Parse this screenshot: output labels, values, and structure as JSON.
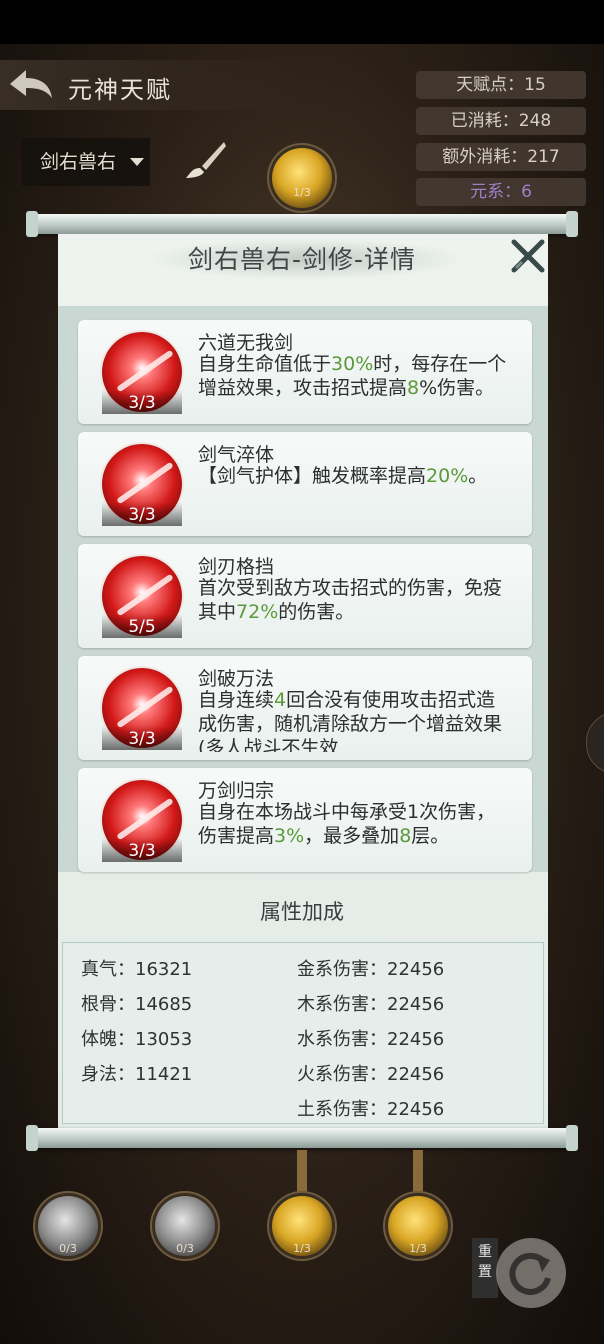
{
  "header": {
    "title": "元神天赋"
  },
  "stats": {
    "talent_points": "天赋点：15",
    "consumed": "已消耗：248",
    "extra_consumed": "额外消耗：217",
    "element": "元系：6"
  },
  "selector": {
    "value": "剑右兽右"
  },
  "nodes": {
    "top": "1/3",
    "bottom": [
      "0/3",
      "0/3",
      "1/3",
      "1/3"
    ]
  },
  "panel": {
    "title": "剑右兽右-剑修-详情",
    "skills": [
      {
        "name": "六道无我剑",
        "level": "3/3",
        "desc": [
          {
            "t": "自身生命值低于"
          },
          {
            "t": "30%",
            "hl": true
          },
          {
            "t": "时，每存在一个增益效果，攻击招式提高"
          },
          {
            "t": "8",
            "hl": true
          },
          {
            "t": "%伤害。"
          }
        ]
      },
      {
        "name": "剑气淬体",
        "level": "3/3",
        "desc": [
          {
            "t": "【剑气护体】触发概率提高"
          },
          {
            "t": "20%",
            "hl": true
          },
          {
            "t": "。"
          }
        ]
      },
      {
        "name": "剑刃格挡",
        "level": "5/5",
        "desc": [
          {
            "t": "首次受到敌方攻击招式的伤害，免疫其中"
          },
          {
            "t": "72%",
            "hl": true
          },
          {
            "t": "的伤害。"
          }
        ]
      },
      {
        "name": "剑破万法",
        "level": "3/3",
        "desc": [
          {
            "t": "自身连续"
          },
          {
            "t": "4",
            "hl": true
          },
          {
            "t": "回合没有使用攻击招式造成伤害，随机清除敌方一个增益效果(多人战斗不生效"
          }
        ]
      },
      {
        "name": "万剑归宗",
        "level": "3/3",
        "desc": [
          {
            "t": "自身在本场战斗中每承受1次伤害，伤害提高"
          },
          {
            "t": "3%",
            "hl": true
          },
          {
            "t": "，最多叠加"
          },
          {
            "t": "8",
            "hl": true
          },
          {
            "t": "层。"
          }
        ]
      }
    ],
    "attributes_heading": "属性加成",
    "attributes_left": [
      "真气：16321",
      "根骨：14685",
      "体魄：13053",
      "身法：11421"
    ],
    "attributes_right": [
      "金系伤害：22456",
      "木系伤害：22456",
      "水系伤害：22456",
      "火系伤害：22456",
      "土系伤害：22456"
    ]
  },
  "reset": {
    "label": "重置"
  }
}
